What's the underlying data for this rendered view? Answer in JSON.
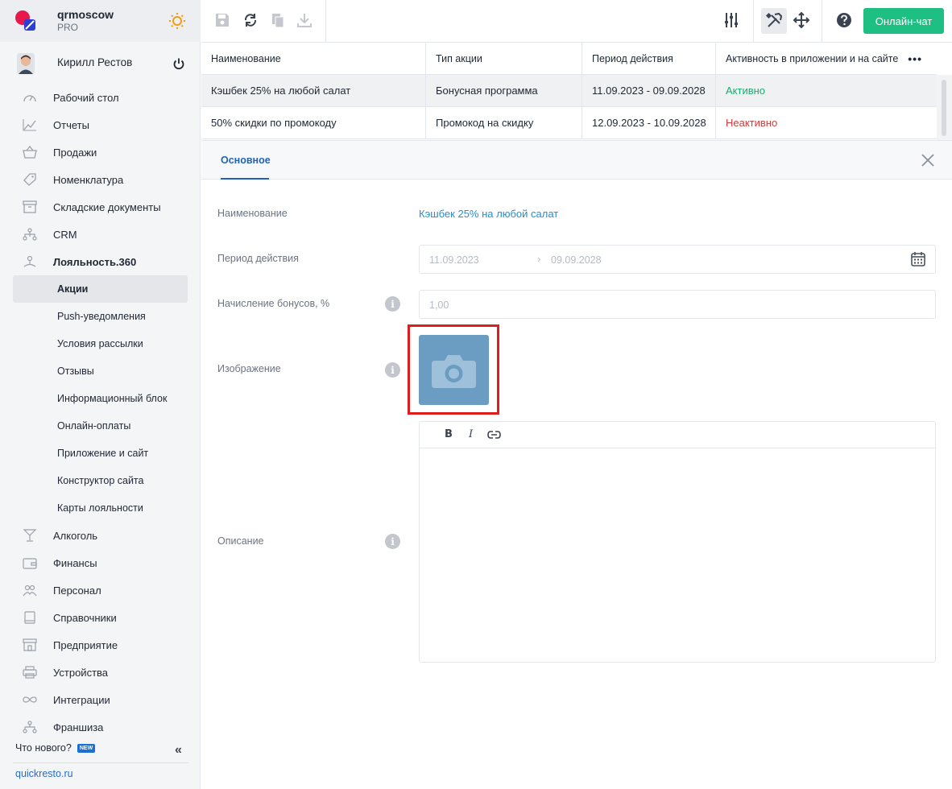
{
  "brand": {
    "name": "qrmoscow",
    "plan": "PRO"
  },
  "user": {
    "name": "Кирилл Рестов"
  },
  "nav": {
    "items": [
      {
        "label": "Рабочий стол"
      },
      {
        "label": "Отчеты"
      },
      {
        "label": "Продажи"
      },
      {
        "label": "Номенклатура"
      },
      {
        "label": "Складские документы"
      },
      {
        "label": "CRM"
      },
      {
        "label": "Лояльность.360"
      }
    ],
    "sub_items": [
      {
        "label": "Акции"
      },
      {
        "label": "Push-уведомления"
      },
      {
        "label": "Условия рассылки"
      },
      {
        "label": "Отзывы"
      },
      {
        "label": "Информационный блок"
      },
      {
        "label": "Онлайн-оплаты"
      },
      {
        "label": "Приложение и сайт"
      },
      {
        "label": "Конструктор сайта"
      },
      {
        "label": "Карты лояльности"
      }
    ],
    "items_after": [
      {
        "label": "Алкоголь"
      },
      {
        "label": "Финансы"
      },
      {
        "label": "Персонал"
      },
      {
        "label": "Справочники"
      },
      {
        "label": "Предприятие"
      },
      {
        "label": "Устройства"
      },
      {
        "label": "Интеграции"
      },
      {
        "label": "Франшиза"
      }
    ]
  },
  "footer": {
    "whats_new": "Что нового?",
    "badge": "NEW",
    "site": "quickresto.ru"
  },
  "toolbar": {
    "chat_label": "Онлайн-чат"
  },
  "table": {
    "headers": [
      "Наименование",
      "Тип акции",
      "Период действия",
      "Активность в приложении и на сайте"
    ],
    "rows": [
      [
        "Кэшбек 25% на любой салат",
        "Бонусная программа",
        "11.09.2023 - 09.09.2028",
        "Активно"
      ],
      [
        "50% скидки по промокоду",
        "Промокод на скидку",
        "12.09.2023 - 10.09.2028",
        "Неактивно"
      ]
    ]
  },
  "detail": {
    "tab": "Основное",
    "labels": {
      "name": "Наименование",
      "period": "Период действия",
      "bonus": "Начисление бонусов, %",
      "image": "Изображение",
      "description": "Описание"
    },
    "name_value": "Кэшбек 25% на любой салат",
    "date_from": "11.09.2023",
    "date_to": "09.09.2028",
    "bonus_placeholder": "1,00",
    "editor_buttons": {
      "bold": "B",
      "italic": "I"
    }
  },
  "colors": {
    "accent": "#1dbf83",
    "active": "#1dab6e",
    "inactive": "#d33b3b",
    "link": "#2a8cc9",
    "highlight": "#e01d1d"
  }
}
